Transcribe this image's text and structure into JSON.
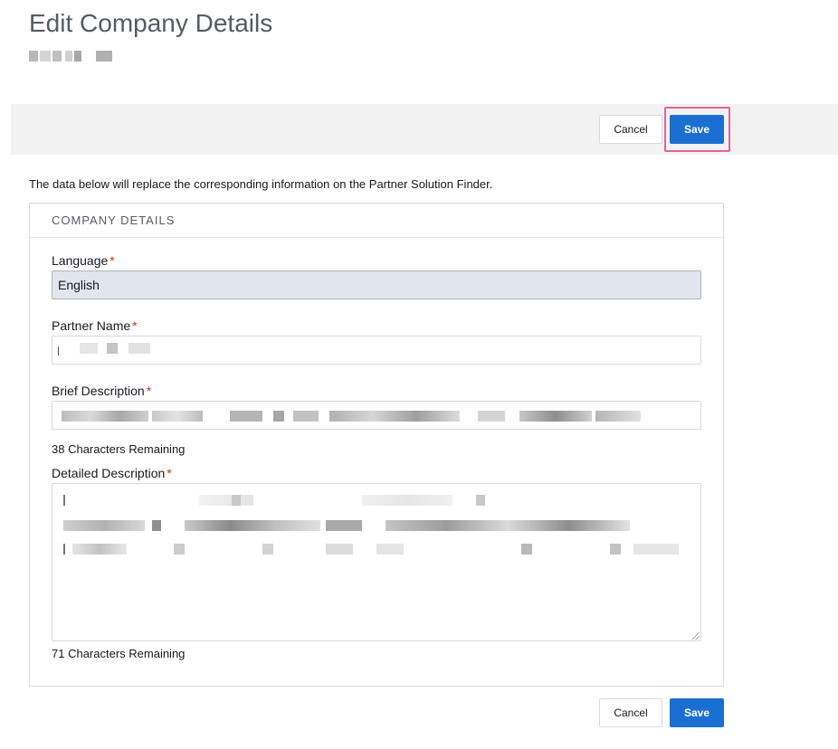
{
  "page": {
    "title": "Edit Company Details"
  },
  "toolbar": {
    "cancel_label": "Cancel",
    "save_label": "Save"
  },
  "intro": "The data below will replace the corresponding information on the Partner Solution Finder.",
  "panel": {
    "heading": "COMPANY DETAILS",
    "fields": {
      "language": {
        "label": "Language",
        "required": "*",
        "value": "English"
      },
      "partner_name": {
        "label": "Partner Name",
        "required": "*",
        "value": ""
      },
      "brief_description": {
        "label": "Brief Description",
        "required": "*",
        "value": "",
        "remaining": "38 Characters Remaining"
      },
      "detailed_description": {
        "label": "Detailed Description",
        "required": "*",
        "value": "",
        "remaining": "71 Characters Remaining"
      }
    }
  },
  "footer": {
    "cancel_label": "Cancel",
    "save_label": "Save"
  },
  "colors": {
    "primary": "#1b6fd2",
    "highlight": "#e0659a",
    "required": "#d13212"
  },
  "icons": [
    "resize-handle-icon"
  ]
}
